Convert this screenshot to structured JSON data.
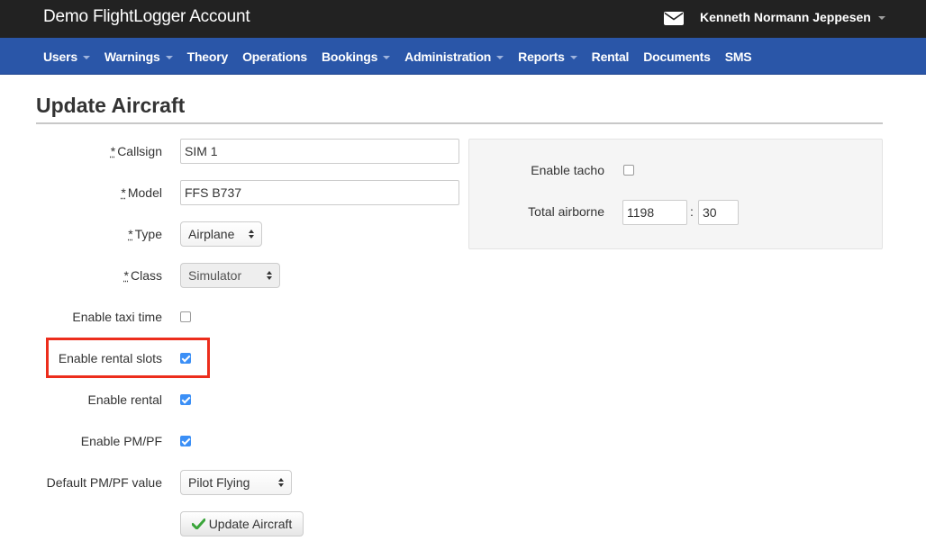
{
  "header": {
    "brand": "Demo FlightLogger Account",
    "user_name": "Kenneth Normann Jeppesen"
  },
  "nav": {
    "items": [
      {
        "label": "Users",
        "dropdown": true
      },
      {
        "label": "Warnings",
        "dropdown": true
      },
      {
        "label": "Theory",
        "dropdown": false
      },
      {
        "label": "Operations",
        "dropdown": false
      },
      {
        "label": "Bookings",
        "dropdown": true
      },
      {
        "label": "Administration",
        "dropdown": true
      },
      {
        "label": "Reports",
        "dropdown": true
      },
      {
        "label": "Rental",
        "dropdown": false
      },
      {
        "label": "Documents",
        "dropdown": false
      },
      {
        "label": "SMS",
        "dropdown": false
      }
    ]
  },
  "page": {
    "title": "Update Aircraft"
  },
  "form": {
    "required_mark": "*",
    "callsign": {
      "label": "Callsign",
      "value": "SIM 1"
    },
    "model": {
      "label": "Model",
      "value": "FFS B737"
    },
    "type": {
      "label": "Type",
      "value": "Airplane"
    },
    "class": {
      "label": "Class",
      "value": "Simulator"
    },
    "taxi_time": {
      "label": "Enable taxi time",
      "checked": false
    },
    "rental_slots": {
      "label": "Enable rental slots",
      "checked": true
    },
    "rental": {
      "label": "Enable rental",
      "checked": true
    },
    "pmpf": {
      "label": "Enable PM/PF",
      "checked": true
    },
    "pmpf_default": {
      "label": "Default PM/PF value",
      "value": "Pilot Flying"
    },
    "submit_label": "Update Aircraft"
  },
  "panel": {
    "tacho": {
      "label": "Enable tacho",
      "checked": false
    },
    "total_airborne": {
      "label": "Total airborne",
      "hours": "1198",
      "separator": ":",
      "minutes": "30"
    }
  },
  "colors": {
    "navbar": "#2a56a8",
    "topbar": "#222222",
    "highlight": "#ec2d1c",
    "checkbox_checked": "#3b8ff6",
    "submit_icon": "#3aa53a"
  }
}
